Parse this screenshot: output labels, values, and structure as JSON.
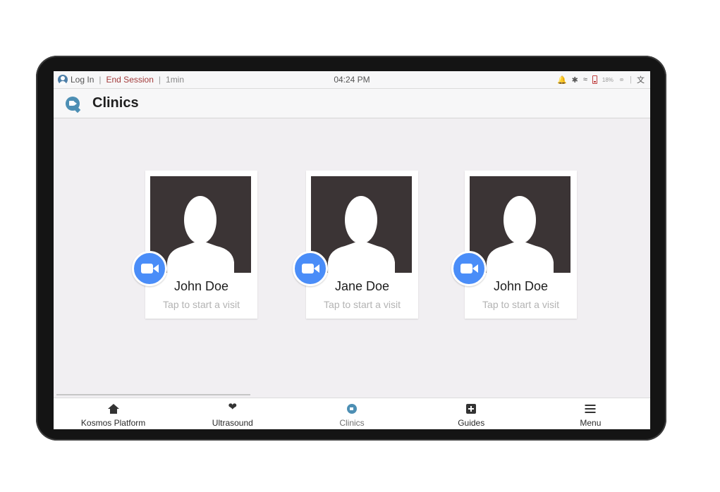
{
  "status_bar": {
    "login_label": "Log In",
    "separator": "|",
    "end_session_label": "End Session",
    "session_duration": "1min",
    "time": "04:24 PM",
    "battery_percent": "18%"
  },
  "header": {
    "title": "Clinics"
  },
  "clinics": [
    {
      "name": "John Doe",
      "hint": "Tap to start a visit"
    },
    {
      "name": "Jane Doe",
      "hint": "Tap to start a visit"
    },
    {
      "name": "John Doe",
      "hint": "Tap to start a visit"
    }
  ],
  "bottom_nav": [
    {
      "label": "Kosmos Platform",
      "icon": "home-icon",
      "active": false
    },
    {
      "label": "Ultrasound",
      "icon": "heart-pulse-icon",
      "active": false
    },
    {
      "label": "Clinics",
      "icon": "clinics-chat-icon",
      "active": true
    },
    {
      "label": "Guides",
      "icon": "plus-box-icon",
      "active": false
    },
    {
      "label": "Menu",
      "icon": "hamburger-menu-icon",
      "active": false
    }
  ],
  "colors": {
    "accent": "#4a8df8",
    "end_session": "#a33b3b",
    "clinics_icon": "#4d8fb4",
    "photo_bg": "#3b3435"
  }
}
